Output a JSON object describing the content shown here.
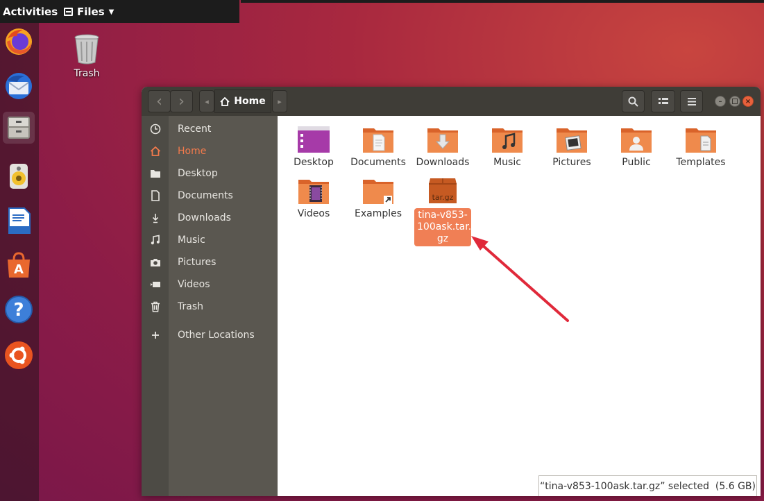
{
  "topbar": {
    "activities": "Activities",
    "app_menu": "Files"
  },
  "desktop": {
    "trash_label": "Trash"
  },
  "dock": {
    "items": [
      "firefox-icon",
      "thunderbird-icon",
      "files-icon",
      "rhythmbox-icon",
      "libreoffice-writer-icon",
      "software-icon",
      "help-icon",
      "ubuntu-icon"
    ]
  },
  "headerbar": {
    "path_label": "Home",
    "back_glyph": "‹",
    "forward_glyph": "›",
    "left_arrow": "◂",
    "right_arrow": "▸"
  },
  "sidebar": {
    "items": [
      {
        "label": "Recent",
        "icon": "clock-icon"
      },
      {
        "label": "Home",
        "icon": "home-icon"
      },
      {
        "label": "Desktop",
        "icon": "folder-icon"
      },
      {
        "label": "Documents",
        "icon": "document-icon"
      },
      {
        "label": "Downloads",
        "icon": "download-icon"
      },
      {
        "label": "Music",
        "icon": "music-icon"
      },
      {
        "label": "Pictures",
        "icon": "camera-icon"
      },
      {
        "label": "Videos",
        "icon": "video-icon"
      },
      {
        "label": "Trash",
        "icon": "trash-icon"
      },
      {
        "label": "Other Locations",
        "icon": "plus-icon"
      }
    ]
  },
  "files": {
    "items": [
      {
        "label": "Desktop"
      },
      {
        "label": "Documents"
      },
      {
        "label": "Downloads"
      },
      {
        "label": "Music"
      },
      {
        "label": "Pictures"
      },
      {
        "label": "Public"
      },
      {
        "label": "Templates"
      },
      {
        "label": "Videos"
      },
      {
        "label": "Examples"
      },
      {
        "label": "tina-v853-100ask.tar.gz",
        "badge": "tar.gz"
      }
    ],
    "selected_line1": "tina-v853-",
    "selected_line2": "100ask.tar.",
    "selected_line3": "gz"
  },
  "status": {
    "text": "“tina-v853-100ask.tar.gz” selected  (5.6 GB)"
  },
  "colors": {
    "accent": "#f07f55",
    "headerbar": "#3f3d37",
    "sidebar": "#5a5750",
    "arrow": "#e0293a"
  }
}
